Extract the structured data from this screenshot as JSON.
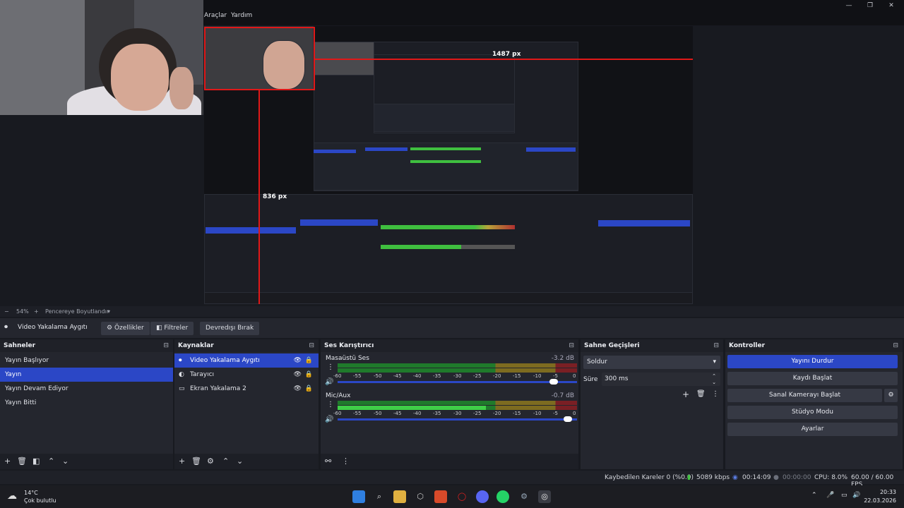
{
  "menu": {
    "tools": "Araçlar",
    "help": "Yardım"
  },
  "window_controls": {
    "minimize": "—",
    "maximize": "❐",
    "close": "✕"
  },
  "preview": {
    "width_label": "1487 px",
    "height_label": "836 px"
  },
  "zoom": {
    "minus": "−",
    "value": "54%",
    "plus": "+",
    "fit": "Pencereye Boyutlandır",
    "chevron": "▾"
  },
  "source_bar": {
    "name": "Video Yakalama Aygıtı",
    "properties": "Özellikler",
    "filters": "Filtreler",
    "deactivate": "Devredışı Bırak"
  },
  "scenes": {
    "title": "Sahneler",
    "items": [
      "Yayın Başlıyor",
      "Yayın",
      "Yayın Devam Ediyor",
      "Yayın Bitti"
    ],
    "selected": 1
  },
  "sources": {
    "title": "Kaynaklar",
    "items": [
      "Video Yakalama Aygıtı",
      "Tarayıcı",
      "Ekran Yakalama 2"
    ],
    "selected": 0
  },
  "mixer": {
    "title": "Ses Karıştırıcı",
    "channels": [
      {
        "name": "Masaüstü Ses",
        "db": "-3.2 dB",
        "volume": 0.92
      },
      {
        "name": "Mic/Aux",
        "db": "-0.7 dB",
        "volume": 0.98
      }
    ],
    "ticks": [
      "-60",
      "-55",
      "-50",
      "-45",
      "-40",
      "-35",
      "-30",
      "-25",
      "-20",
      "-15",
      "-10",
      "-5",
      "0"
    ]
  },
  "transitions": {
    "title": "Sahne Geçişleri",
    "type": "Soldur",
    "duration_label": "Süre",
    "duration": "300 ms"
  },
  "controls": {
    "title": "Kontroller",
    "buttons": [
      "Yayını Durdur",
      "Kaydı Başlat",
      "Sanal Kamerayı Başlat",
      "Stüdyo Modu",
      "Ayarlar"
    ]
  },
  "status": {
    "dropped": "Kaybedilen Kareler 0 (%0.0)",
    "bitrate": "5089 kbps",
    "stream_time": "00:14:09",
    "rec_time": "00:00:00",
    "cpu": "CPU: 8.0%",
    "fps": "60.00 / 60.00 FPS"
  },
  "taskbar": {
    "temp": "14°C",
    "weather": "Çok bulutlu",
    "time": "20:33",
    "date": "22.03.2026"
  }
}
